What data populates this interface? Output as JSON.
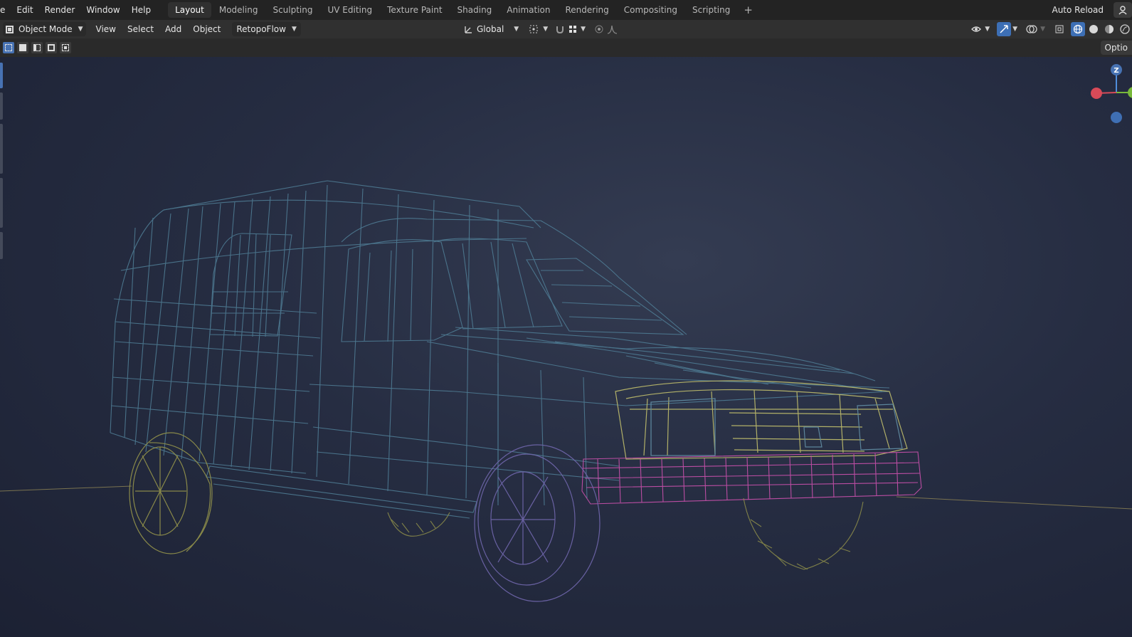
{
  "topbar": {
    "menus": [
      "e",
      "Edit",
      "Render",
      "Window",
      "Help"
    ],
    "workspaces": [
      "Layout",
      "Modeling",
      "Sculpting",
      "UV Editing",
      "Texture Paint",
      "Shading",
      "Animation",
      "Rendering",
      "Compositing",
      "Scripting"
    ],
    "active_workspace": "Layout",
    "add_workspace_icon": "+",
    "auto_reload": "Auto Reload"
  },
  "header": {
    "mode": "Object Mode",
    "menus": [
      "View",
      "Select",
      "Add",
      "Object"
    ],
    "addon_menu": "RetopoFlow",
    "transform_orientation": "Global"
  },
  "toolbar": {
    "select_modes": [
      "box-select-new",
      "box-select-extend",
      "box-select-subtract",
      "box-select-invert",
      "box-select-intersect"
    ],
    "active_select_mode": 0,
    "options_label": "Optio"
  },
  "viewport": {
    "gizmo_axes": {
      "z_label": "Z"
    },
    "colors": {
      "body_wire": "#4e7a92",
      "hood_wire": "#5f8aa0",
      "grille_wire": "#b9b76a",
      "bumper_wire": "#c24fa8",
      "wheel_wire": "#8f8f4a",
      "front_wheel_wire": "#6d64a8",
      "floor_line": "#7a7350",
      "accent_blue": "#4772b3"
    }
  }
}
